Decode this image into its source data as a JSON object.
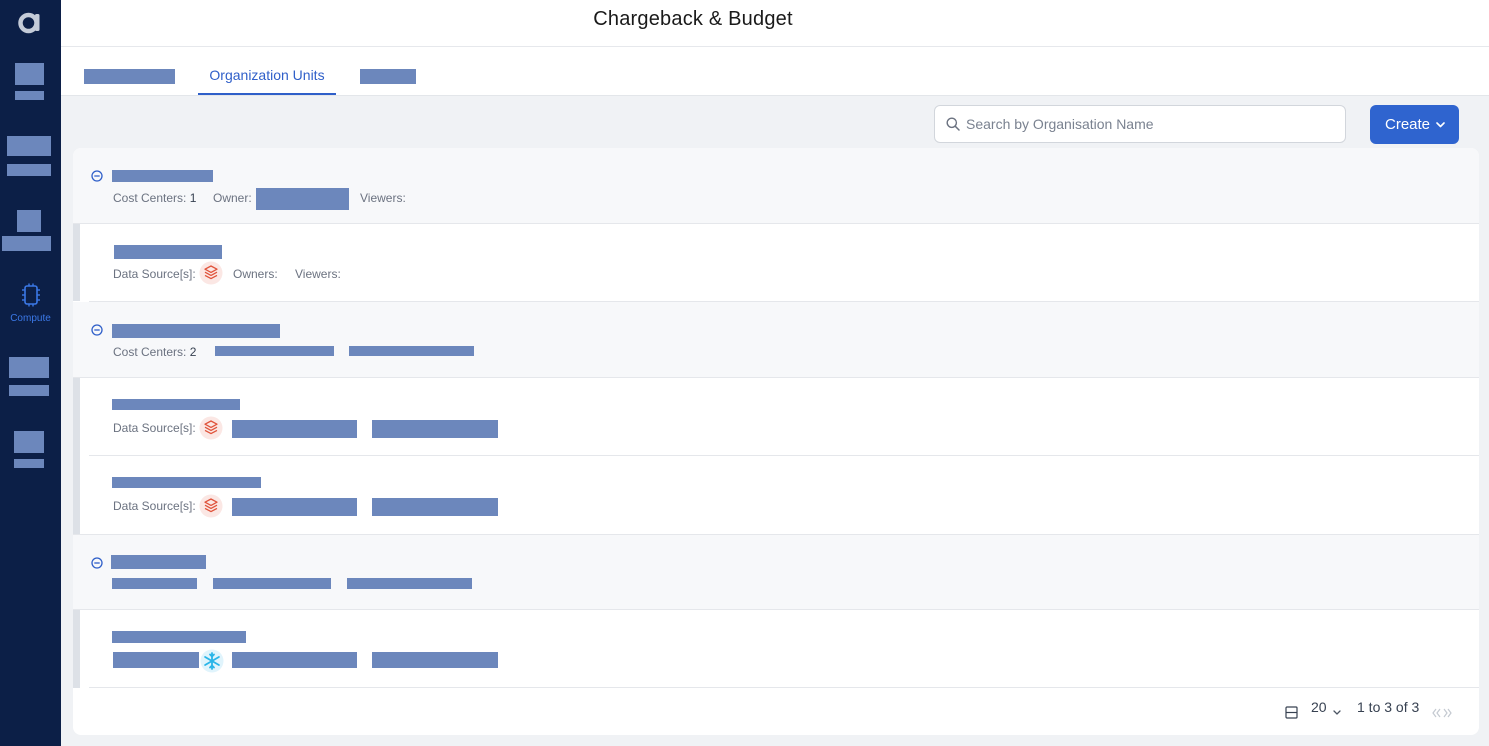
{
  "header": {
    "title": "Chargeback & Budget"
  },
  "sidebar": {
    "compute_label": "Compute"
  },
  "tabs": {
    "active_label": "Organization Units"
  },
  "search": {
    "placeholder": "Search by Organisation Name",
    "value": ""
  },
  "toolbar": {
    "create_label": "Create"
  },
  "orgs": [
    {
      "cost_centers_label": "Cost Centers:",
      "cost_centers_count": "1",
      "owner_label": "Owner:",
      "viewers_label": "Viewers:"
    },
    {
      "cost_centers_label": "Cost Centers:",
      "cost_centers_count": "2"
    }
  ],
  "cost_center_rows": [
    {
      "data_sources_label": "Data Source[s]:",
      "owners_label": "Owners:",
      "viewers_label": "Viewers:"
    },
    {
      "data_sources_label": "Data Source[s]:"
    },
    {
      "data_sources_label": "Data Source[s]:"
    }
  ],
  "pagination": {
    "page_size": "20",
    "range_text": "1 to 3 of 3"
  },
  "colors": {
    "sidebar": "#0c1f47",
    "accent": "#2f64cf",
    "redaction": "#6c87bc"
  }
}
